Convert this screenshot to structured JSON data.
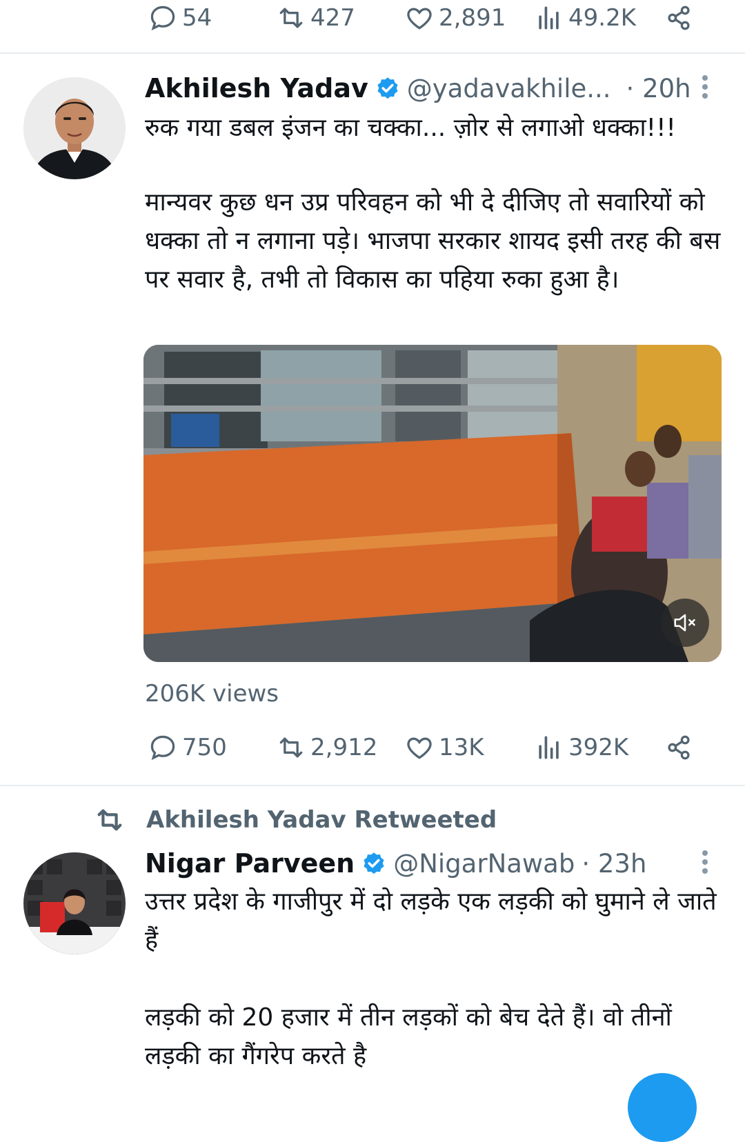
{
  "top_actions": {
    "replies": "54",
    "retweets": "427",
    "likes": "2,891",
    "views": "49.2K"
  },
  "tweet1": {
    "name": "Akhilesh Yadav",
    "handle": "@yadavakhile...",
    "time": "· 20h",
    "text_line1": "रुक गया डबल इंजन का चक्का... ज़ोर से लगाओ धक्का!!!",
    "text_para2": "मान्यवर कुछ धन उप्र परिवहन को भी दे दीजिए तो सवारियों को धक्का तो न लगाना पड़े। भाजपा सरकार शायद इसी तरह की बस पर सवार है, तभी तो विकास का पहिया रुका हुआ है।",
    "video_views": "206K views",
    "actions": {
      "replies": "750",
      "retweets": "2,912",
      "likes": "13K",
      "views": "392K"
    }
  },
  "retweet_label": "Akhilesh Yadav Retweeted",
  "tweet2": {
    "name": "Nigar Parveen",
    "handle": "@NigarNawab",
    "time": "· 23h",
    "text_para1": "उत्तर प्रदेश के गाजीपुर में दो लड़के एक लड़की को घुमाने ले जाते हैं",
    "text_para2": "लड़की को 20 हजार में तीन लड़कों को बेच देते हैं। वो तीनों लड़की का गैंगरेप करते है"
  },
  "colors": {
    "verified": "#1d9bf0",
    "secondary_text": "#536471",
    "accent": "#1d9bf0"
  }
}
